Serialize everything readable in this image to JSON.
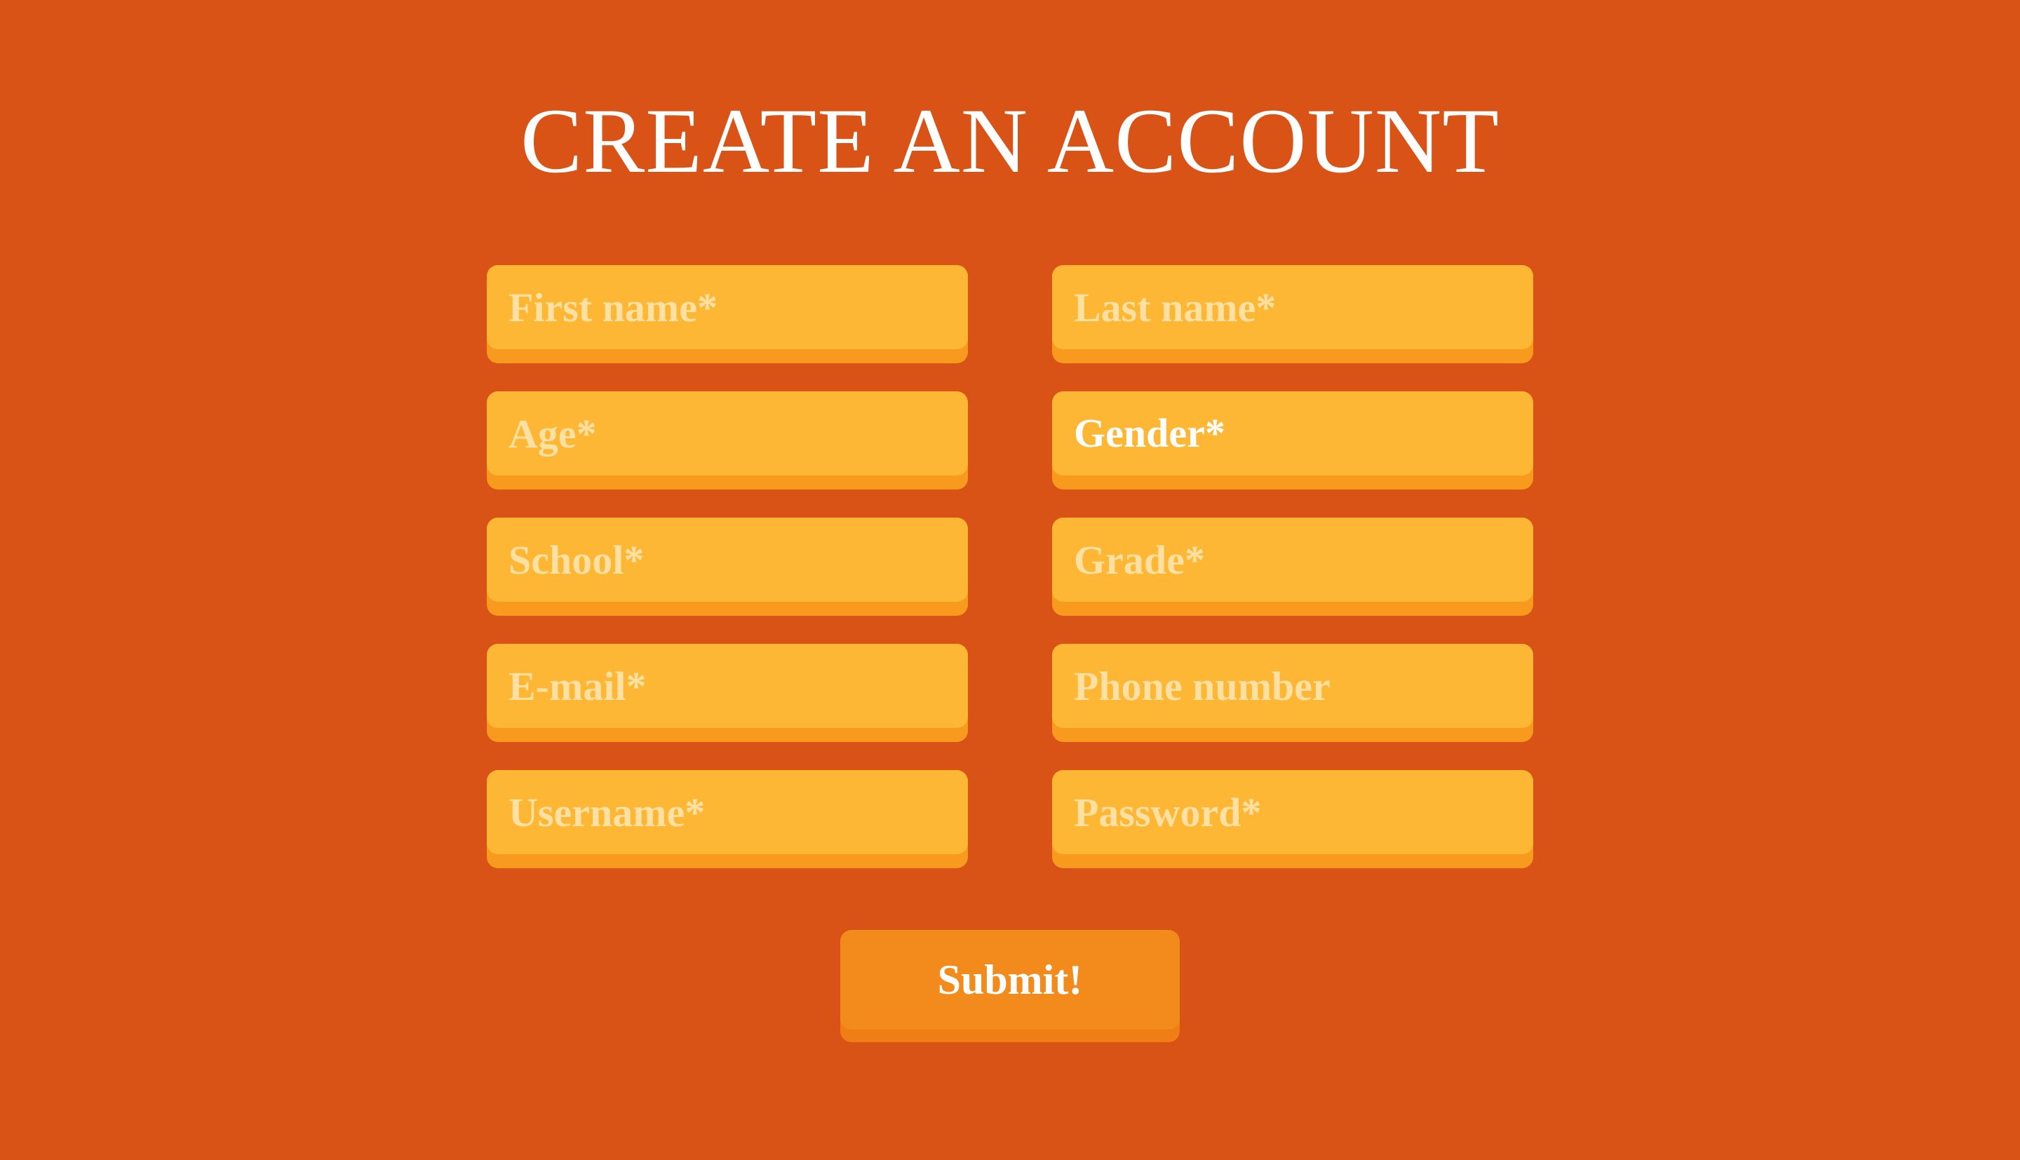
{
  "page": {
    "title": "CREATE AN ACCOUNT"
  },
  "colors": {
    "background": "#D95216",
    "field_fill": "#FEB734",
    "field_shadow": "#F79A1E",
    "placeholder_text": "#FDE0A2",
    "button_fill": "#F28A1C",
    "button_shadow": "#F07E16",
    "text": "#FFFFFF"
  },
  "form": {
    "first_name": {
      "placeholder": "First name*",
      "value": ""
    },
    "last_name": {
      "placeholder": "Last name*",
      "value": ""
    },
    "age": {
      "placeholder": "Age*",
      "value": ""
    },
    "gender": {
      "selected": "Gender*"
    },
    "school": {
      "placeholder": "School*",
      "value": ""
    },
    "grade": {
      "placeholder": "Grade*",
      "value": ""
    },
    "email": {
      "placeholder": "E-mail*",
      "value": ""
    },
    "phone": {
      "placeholder": "Phone number",
      "value": ""
    },
    "username": {
      "placeholder": "Username*",
      "value": ""
    },
    "password": {
      "placeholder": "Password*",
      "value": ""
    },
    "submit_label": "Submit!"
  }
}
